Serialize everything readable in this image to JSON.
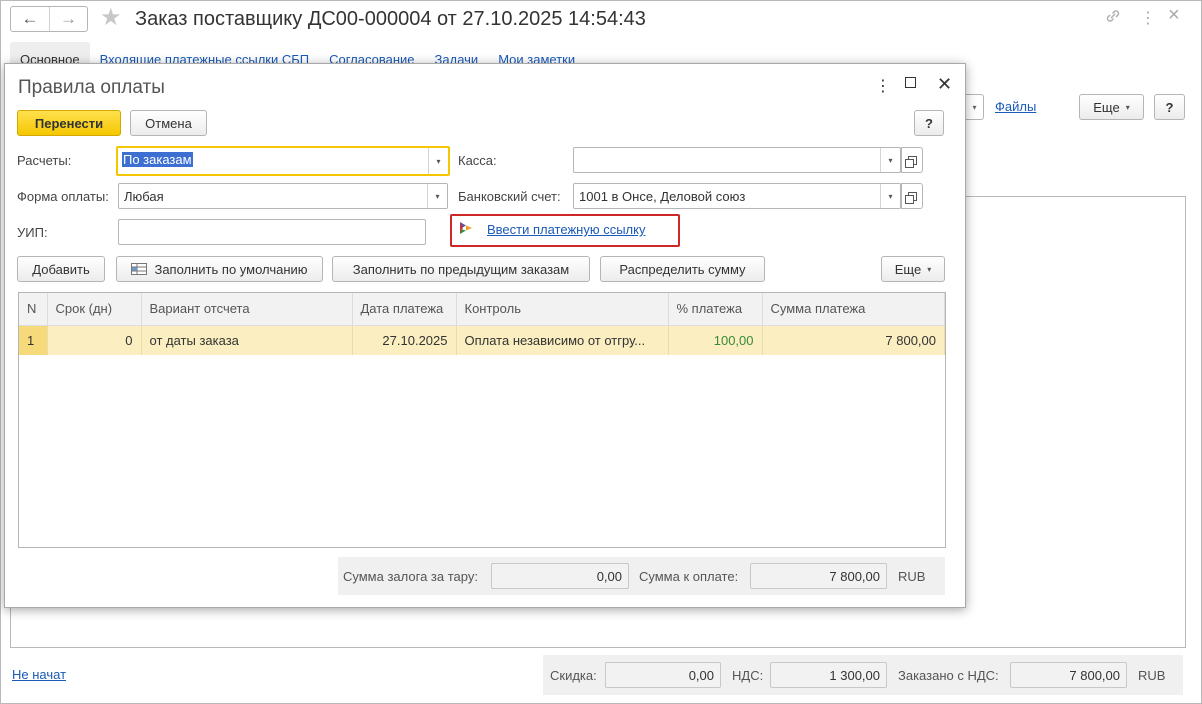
{
  "header": {
    "title": "Заказ поставщику ДС00-000004 от 27.10.2025 14:54:43",
    "back_glyph": "🡐",
    "forward_glyph": "🡒",
    "star_glyph": "★",
    "link_glyph": "🔗",
    "more_glyph": "⋮",
    "close_glyph": "×"
  },
  "tabs": [
    {
      "label": "Основное"
    },
    {
      "label": "Входящие платежные ссылки СБП"
    },
    {
      "label": "Согласование"
    },
    {
      "label": "Задачи"
    },
    {
      "label": "Мои заметки"
    }
  ],
  "background_toolbar": {
    "files_link": "Файлы",
    "more_label": "Еще",
    "help_label": "?"
  },
  "status": {
    "link": "Не начат"
  },
  "footer": {
    "discount_label": "Скидка:",
    "discount_value": "0,00",
    "vat_label": "НДС:",
    "vat_value": "1 300,00",
    "ordered_label": "Заказано с НДС:",
    "ordered_value": "7 800,00",
    "currency": "RUB"
  },
  "dialog": {
    "title": "Правила оплаты",
    "more_glyph": "⋮",
    "maximize_glyph": "☐",
    "close_glyph": "✕",
    "transfer_label": "Перенести",
    "cancel_label": "Отмена",
    "help_label": "?",
    "settlements_label": "Расчеты:",
    "settlements_value": "По заказам",
    "payment_form_label": "Форма оплаты:",
    "payment_form_value": "Любая",
    "uip_label": "УИП:",
    "uip_value": "",
    "cash_label": "Касса:",
    "cash_value": "",
    "bank_account_label": "Банковский счет:",
    "bank_account_value": "1001 в Онсе, Деловой союз",
    "payment_link_label": "Ввести платежную ссылку",
    "toolbar": {
      "add": "Добавить",
      "fill_default": "Заполнить по умолчанию",
      "fill_previous": "Заполнить по предыдущим заказам",
      "distribute": "Распределить сумму",
      "more": "Еще"
    },
    "table": {
      "columns": [
        "N",
        "Срок (дн)",
        "Вариант отсчета",
        "Дата платежа",
        "Контроль",
        "% платежа",
        "Сумма платежа"
      ],
      "rows": [
        [
          "1",
          "0",
          "от даты заказа",
          "27.10.2025",
          "Оплата независимо от отгру...",
          "100,00",
          "7 800,00"
        ]
      ]
    },
    "totals": {
      "deposit_label": "Сумма залога за тару:",
      "deposit_value": "0,00",
      "to_pay_label": "Сумма к оплате:",
      "to_pay_value": "7 800,00",
      "currency": "RUB"
    }
  },
  "colors": {
    "accent_yellow": "#f5c700",
    "link_blue": "#1a5ab8",
    "highlight_red": "#cf2626",
    "selected_row": "#fbeec0",
    "percent_green": "#3a8a3a"
  }
}
